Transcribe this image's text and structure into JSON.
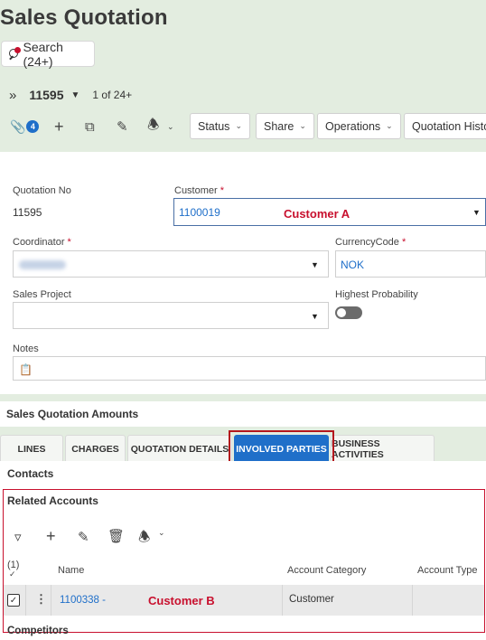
{
  "page": {
    "title": "Sales Quotation"
  },
  "search": {
    "label": "Search (24+)"
  },
  "record": {
    "id": "11595",
    "count": "1 of 24+"
  },
  "toolbar": {
    "attachments_count": "4",
    "buttons": [
      {
        "label": "Status"
      },
      {
        "label": "Share"
      },
      {
        "label": "Operations"
      },
      {
        "label": "Quotation Histor"
      }
    ]
  },
  "form": {
    "quotation_no": {
      "label": "Quotation No",
      "value": "11595"
    },
    "customer": {
      "label": "Customer",
      "required": "*",
      "value": "1100019",
      "annotation": "Customer A"
    },
    "coordinator": {
      "label": "Coordinator",
      "required": "*"
    },
    "currency": {
      "label": "CurrencyCode",
      "required": "*",
      "value": "NOK"
    },
    "sales_project": {
      "label": "Sales Project"
    },
    "highest_probability": {
      "label": "Highest Probability"
    },
    "notes": {
      "label": "Notes"
    }
  },
  "amounts": {
    "title": "Sales Quotation Amounts"
  },
  "tabs": [
    {
      "label": "LINES"
    },
    {
      "label": "CHARGES"
    },
    {
      "label": "QUOTATION DETAILS"
    },
    {
      "label": "INVOLVED PARTIES"
    },
    {
      "label": "BUSINESS ACTIVITIES"
    }
  ],
  "contacts": {
    "title": "Contacts"
  },
  "related_accounts": {
    "title": "Related Accounts",
    "selection_count": "(1)",
    "columns": [
      "Name",
      "Account Category",
      "Account Type"
    ],
    "rows": [
      {
        "name": "1100338 -",
        "annotation": "Customer B",
        "category": "Customer",
        "type": ""
      }
    ]
  },
  "competitors": {
    "title": "Competitors"
  },
  "colors": {
    "accent": "#1f6fc9",
    "annotation": "#c8102e",
    "background": "#e3ede0"
  }
}
